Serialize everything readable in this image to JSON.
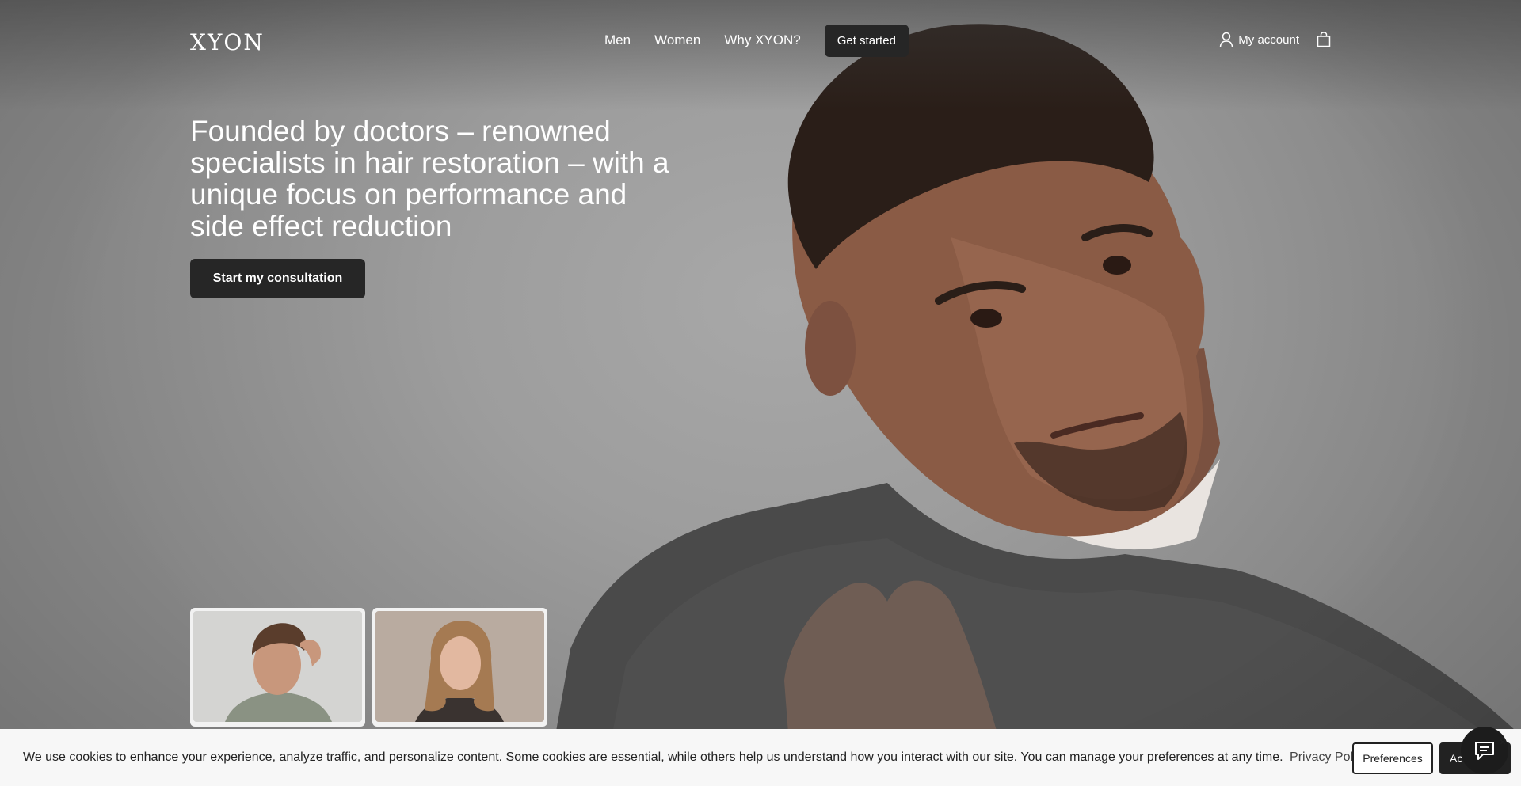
{
  "header": {
    "logo": "XYON",
    "nav": [
      {
        "label": "Men"
      },
      {
        "label": "Women"
      },
      {
        "label": "Why XYON?"
      }
    ],
    "get_started": "Get started",
    "account_label": "My account"
  },
  "hero": {
    "headline": "Founded by doctors – renowned specialists in hair restoration – with a unique focus on performance and side effect reduction",
    "cta": "Start my consultation"
  },
  "cookie_bar": {
    "text": "We use cookies to enhance your experience, analyze traffic, and personalize content. Some cookies are essential, while others help us understand how you interact with our site. You can manage your preferences at any time.",
    "privacy_link": "Privacy Policy",
    "preferences": "Preferences",
    "accept": "Ac",
    "close": "×"
  },
  "colors": {
    "dark_button": "#262626",
    "cookie_bg": "#f7f7f7",
    "hero_bg": "#9d9d9d"
  },
  "icons": {
    "account": "user-icon",
    "cart": "bag-icon",
    "chat": "chat-icon"
  }
}
